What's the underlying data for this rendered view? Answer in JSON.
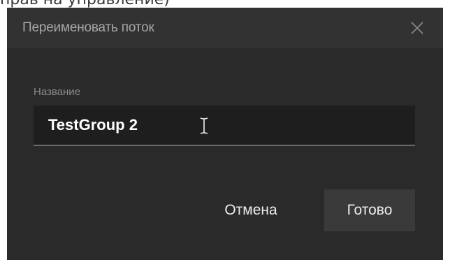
{
  "page": {
    "fragment_text": "прав на управление)"
  },
  "dialog": {
    "title": "Переименовать поток",
    "close_icon": "close-icon",
    "field": {
      "label": "Название",
      "value": "TestGroup 2",
      "cursor_icon": "text-cursor-icon"
    },
    "buttons": {
      "cancel_label": "Отмена",
      "done_label": "Готово"
    }
  },
  "colors": {
    "dialog_bg": "#2a2a2a",
    "header_bg": "#323232",
    "input_bg": "#1e1e1e",
    "primary_button_bg": "#3a3a3a",
    "text": "#ececec",
    "muted_text": "#a6a6a6"
  }
}
